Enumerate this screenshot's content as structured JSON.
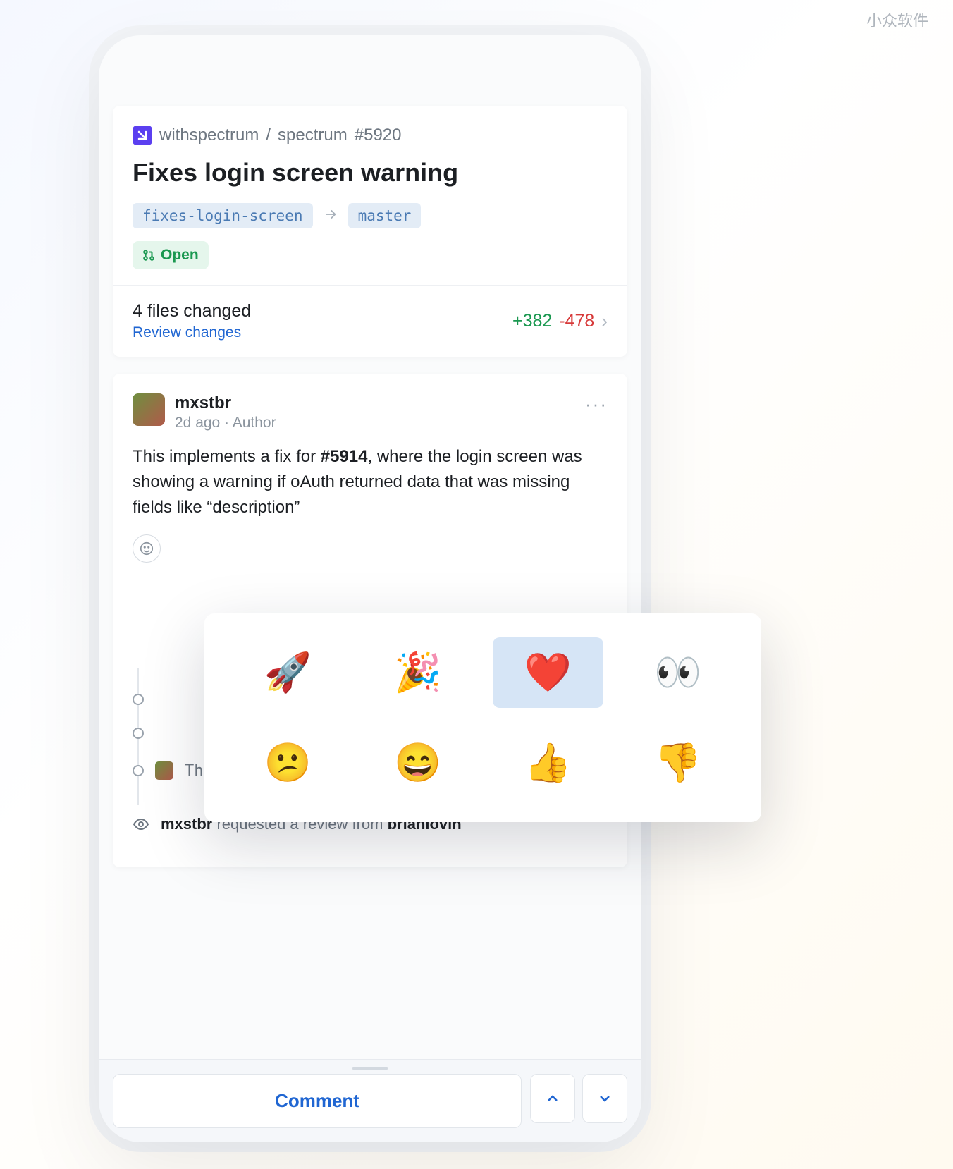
{
  "watermark": "小众软件",
  "repo": {
    "owner": "withspectrum",
    "name": "spectrum",
    "issue_number": "#5920"
  },
  "pr": {
    "title": "Fixes login screen warning",
    "source_branch": "fixes-login-screen",
    "target_branch": "master",
    "status": "Open"
  },
  "diff": {
    "files_changed": "4 files changed",
    "review_link": "Review changes",
    "additions": "+382",
    "deletions": "-478"
  },
  "comment": {
    "author": "mxstbr",
    "meta": "2d ago · Author",
    "body_prefix": "This implements a fix for ",
    "body_issue": "#5914",
    "body_suffix": ", where the login screen was showing a warning if oAuth returned data that was missing fields like “description”"
  },
  "commits": {
    "c3_text": "Throw if oauth times out"
  },
  "review_request": {
    "requester": "mxstbr",
    "middle": " requested a review from ",
    "reviewer": "brianlovin"
  },
  "bottom": {
    "comment_label": "Comment"
  },
  "emojis": {
    "rocket": "🚀",
    "tada": "🎉",
    "heart": "❤️",
    "eyes": "👀",
    "confused": "😕",
    "grin": "😄",
    "thumbs_up": "👍",
    "thumbs_down": "👎"
  }
}
